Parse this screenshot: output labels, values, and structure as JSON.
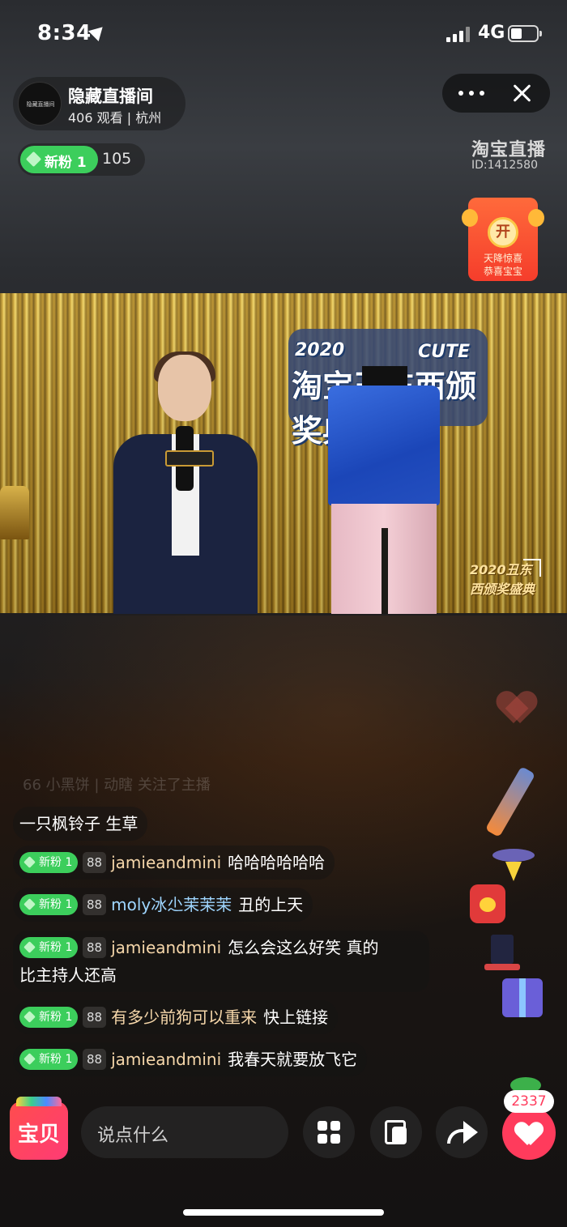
{
  "status_bar": {
    "time": "8:34",
    "network": "4G"
  },
  "host": {
    "avatar_text": "隐藏直播间",
    "name": "隐藏直播间",
    "viewers": "406 观看 | 杭州"
  },
  "fans": {
    "badge_label": "新粉 1",
    "count": "105"
  },
  "brand": {
    "name": "淘宝直播",
    "id": "ID:1412580"
  },
  "red_packet": {
    "coin": "开",
    "line1": "天降惊喜",
    "line2": "恭喜宝宝"
  },
  "video": {
    "logo_year": "2020",
    "logo_cute": "CUTE",
    "logo_main": "淘宝丑东西颁奖典",
    "watermark": "2020丑东西颁奖盛典"
  },
  "chat": {
    "faded_message": "66 小黑饼 | 动瞎 关注了主播",
    "messages": [
      {
        "badge": "",
        "level": "",
        "user": "",
        "text": "一只枫铃子 生草"
      },
      {
        "badge": "新粉 1",
        "level": "88",
        "user": "jamieandmini",
        "text": "哈哈哈哈哈哈"
      },
      {
        "badge": "新粉 1",
        "level": "88",
        "user": "moly冰尐茉茉茉",
        "text": "丑的上天"
      },
      {
        "badge": "新粉 1",
        "level": "88",
        "user": "jamieandmini",
        "text": "怎么会这么好笑 真的",
        "text2": "比主持人还高"
      },
      {
        "badge": "新粉 1",
        "level": "88",
        "user": "有多少前狗可以重来",
        "text": "快上链接"
      },
      {
        "badge": "新粉 1",
        "level": "88",
        "user": "jamieandmini",
        "text": "我春天就要放飞它"
      }
    ]
  },
  "bottom_bar": {
    "shop_label": "宝贝",
    "comment_placeholder": "说点什么",
    "like_count": "2337"
  }
}
